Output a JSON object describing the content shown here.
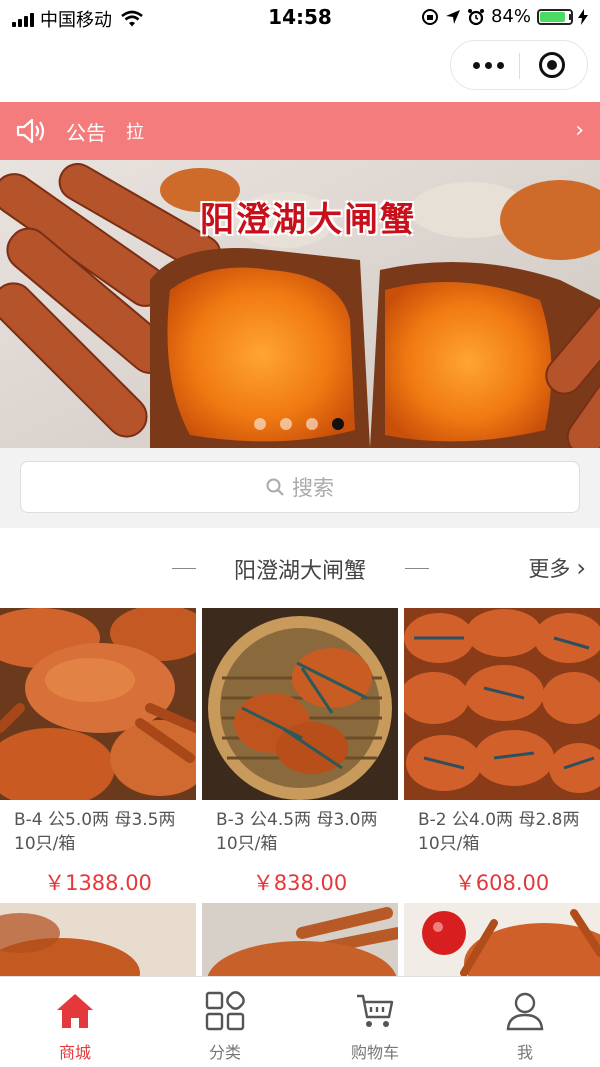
{
  "status_bar": {
    "carrier": "中国移动",
    "time": "14:58",
    "battery": "84%",
    "battery_level": 0.84
  },
  "notice": {
    "label": "公告",
    "text": "拉"
  },
  "banner": {
    "title": "阳澄湖大闸蟹",
    "slide_count": 4,
    "active_slide": 4
  },
  "search": {
    "placeholder": "搜索"
  },
  "section": {
    "title": "阳澄湖大闸蟹",
    "more": "更多"
  },
  "products": [
    {
      "name": "B-4 公5.0两 母3.5两 10只/箱",
      "price": "￥1388.00"
    },
    {
      "name": "B-3 公4.5两 母3.0两 10只/箱",
      "price": "￥838.00"
    },
    {
      "name": "B-2 公4.0两 母2.8两 10只/箱",
      "price": "￥608.00"
    }
  ],
  "tab_bar": [
    {
      "label": "商城",
      "icon": "home-icon",
      "active": true
    },
    {
      "label": "分类",
      "icon": "grid-icon",
      "active": false
    },
    {
      "label": "购物车",
      "icon": "cart-icon",
      "active": false
    },
    {
      "label": "我",
      "icon": "user-icon",
      "active": false
    }
  ],
  "colors": {
    "notice_bg": "#f47c7c",
    "accent": "#e4393c"
  }
}
